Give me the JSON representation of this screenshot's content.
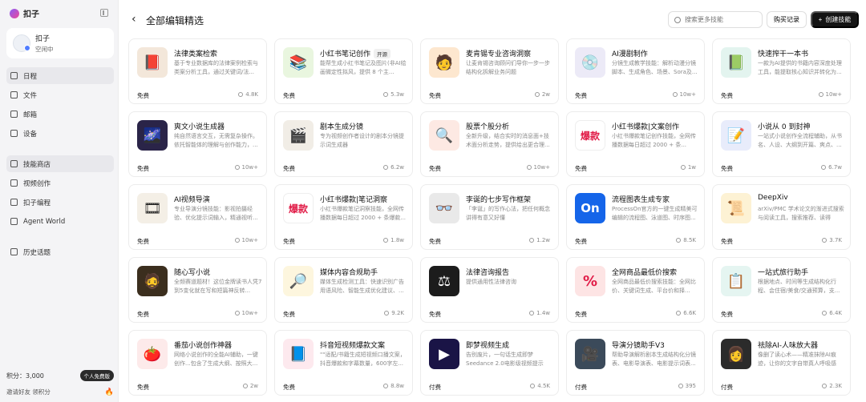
{
  "app": {
    "name": "扣子"
  },
  "user": {
    "name": "扣子",
    "status": "空闲中"
  },
  "nav_top": [
    {
      "label": "日程",
      "icon": "calendar-icon",
      "active": true
    },
    {
      "label": "文件",
      "icon": "folder-icon",
      "active": false
    },
    {
      "label": "邮箱",
      "icon": "mail-icon",
      "active": false
    },
    {
      "label": "设备",
      "icon": "device-icon",
      "active": false
    }
  ],
  "nav_mid": [
    {
      "label": "技能商店",
      "icon": "store-icon",
      "active": true
    },
    {
      "label": "视频创作",
      "icon": "video-icon",
      "active": false
    },
    {
      "label": "扣子编程",
      "icon": "code-icon",
      "active": false
    },
    {
      "label": "Agent World",
      "icon": "world-icon",
      "active": false
    }
  ],
  "nav_bottom": [
    {
      "label": "历史话题",
      "icon": "history-icon",
      "active": false
    }
  ],
  "footer": {
    "points": "积分：3,000",
    "plan": "个人免费版",
    "invite": "邀请好友 领积分"
  },
  "header": {
    "title": "全部编辑精选",
    "search_placeholder": "搜索更多技能",
    "buy_label": "购买记录",
    "create_label": "创建技能"
  },
  "cards": [
    {
      "title": "法律类案检索",
      "tag": "",
      "desc": "基于专业数据库的法律案例检索与类案分析工具，通过关键词/法...",
      "price": "免费",
      "users": "4.8K",
      "thumb": "📕",
      "bg": "#f3e7da"
    },
    {
      "title": "小红书笔记创作",
      "tag": "开源",
      "desc": "能帮生成小红书笔记及图片(非AI绘画微定性拟风，提供 8 个主...",
      "price": "免费",
      "users": "5.3w",
      "thumb": "📚",
      "bg": "#e9f6df"
    },
    {
      "title": "麦肯锡专业咨询洞察",
      "tag": "",
      "desc": "让麦肯锡咨询顾问们导你一步一步结构化拆解业务问题",
      "price": "免费",
      "users": "2w",
      "thumb": "🧑",
      "bg": "#fde7cf"
    },
    {
      "title": "AI漫剧制作",
      "tag": "",
      "desc": "分镜生成教学技能：解析动漫分镜脚本、生成角色、场景、Sora及...",
      "price": "免费",
      "users": "10w+",
      "thumb": "💿",
      "bg": "#eceaf7"
    },
    {
      "title": "快速搾干一本书",
      "tag": "",
      "desc": "一款为AI提供的书籍内容深度处理工具，能提取核心知识并转化为...",
      "price": "免费",
      "users": "10w+",
      "thumb": "📗",
      "bg": "#e3f4ef"
    },
    {
      "title": "爽文小说生成器",
      "tag": "",
      "desc": "纯自然语言交互，无需复杂操作。依托智能体的理解与创作能力，...",
      "price": "免费",
      "users": "10w+",
      "thumb": "🌌",
      "bg": "#2a2448"
    },
    {
      "title": "剧本生成分镜",
      "tag": "",
      "desc": "专为视频创作者设计的剧本分镜提示词生成器",
      "price": "免费",
      "users": "6.2w",
      "thumb": "🎬",
      "bg": "#f1ede6"
    },
    {
      "title": "股票个股分析",
      "tag": "",
      "desc": "全新升级，结合实时的消息面+技术面分析走势，提供给出更合理...",
      "price": "免费",
      "users": "10w+",
      "thumb": "🔍",
      "bg": "#fde9e3"
    },
    {
      "title": "小红书爆款|文案创作",
      "tag": "",
      "desc": "小红书爆款笔记创作技能，全网传播数据每日超过 2000 + 条...",
      "price": "免费",
      "users": "1w",
      "thumb": "爆款",
      "bg": "#ffffff"
    },
    {
      "title": "小说从 0 到封神",
      "tag": "",
      "desc": "一站式小说创作全流程辅助，从书名、人设、大纲到开篇、爽点、...",
      "price": "免费",
      "users": "6.7w",
      "thumb": "📝",
      "bg": "#e8ecfb"
    },
    {
      "title": "AI视频导演",
      "tag": "",
      "desc": "专业导演分镜技能：影视拍摄经验、优化提示词输入，精通视听...",
      "price": "免费",
      "users": "10w+",
      "thumb": "🎞",
      "bg": "#f4efe6"
    },
    {
      "title": "小红书爆款|笔记洞察",
      "tag": "",
      "desc": "小红书爆款笔记洞察技能，全网传播数据每日超过 2000 + 条爆款...",
      "price": "免费",
      "users": "1.8w",
      "thumb": "爆款",
      "bg": "#ffffff"
    },
    {
      "title": "李诞的七步写作框架",
      "tag": "",
      "desc": "「李诞」的写作心法，把任何概念讲得有意又好懂",
      "price": "免费",
      "users": "1.2w",
      "thumb": "👓",
      "bg": "#e9e9e9"
    },
    {
      "title": "流程图表生成专家",
      "tag": "",
      "desc": "ProcessOn官方的一键生成精美可编辑的流程图、泳道图、时序图...",
      "price": "免费",
      "users": "8.5K",
      "thumb": "On",
      "bg": "#1565e9"
    },
    {
      "title": "DeepXiv",
      "tag": "",
      "desc": "arXiv/PMC 学术论文的渐进式搜索与阅读工具，搜索推荐、读得着。...",
      "price": "免费",
      "users": "3.7K",
      "thumb": "📜",
      "bg": "#fdf2d4"
    },
    {
      "title": "随心写小说",
      "tag": "",
      "desc": "全频赛道题材！这位金牌读书人凭7到5变化就在写和短篇神反转...",
      "price": "免费",
      "users": "10w+",
      "thumb": "🧔",
      "bg": "#3b2e1e"
    },
    {
      "title": "媒体内容合规助手",
      "tag": "",
      "desc": "媒体生成检测工具：快速识别广告用语风险、智能生成优化建议、...",
      "price": "免费",
      "users": "9.2K",
      "thumb": "🔎",
      "bg": "#fdf6de"
    },
    {
      "title": "法律咨询报告",
      "tag": "",
      "desc": "提供通用性法律咨询",
      "price": "免费",
      "users": "1.4w",
      "thumb": "⚖",
      "bg": "#1c1c1c"
    },
    {
      "title": "全网商品最低价搜索",
      "tag": "",
      "desc": "全网商品最低价搜索技能：全网比价、关键词生成、平台价和择...",
      "price": "免费",
      "users": "6.6K",
      "thumb": "%",
      "bg": "#fde4e4"
    },
    {
      "title": "一站式旅行助手",
      "tag": "",
      "desc": "根据地点、时间等生成结构化行程、会住宿/美食/交通预算，支...",
      "price": "免费",
      "users": "6.4K",
      "thumb": "📋",
      "bg": "#e5f5f1"
    },
    {
      "title": "番茄小说创作神器",
      "tag": "",
      "desc": "网络小说创作的全能AI辅助，一键创作...包含了生成大纲、按照大...",
      "price": "免费",
      "users": "2w",
      "thumb": "🍅",
      "bg": "#fdeaea"
    },
    {
      "title": "抖音短视频爆款文案",
      "tag": "",
      "desc": "\"\"适配/书籍生成短视频口播文案，抖音爆款和字幕数量，600字左...",
      "price": "免费",
      "users": "8.8w",
      "thumb": "📘",
      "bg": "#fde9ee"
    },
    {
      "title": "即梦视频生成",
      "tag": "",
      "desc": "告别废片，一句话生成即梦Seedance 2.0电影级视频提示词。",
      "price": "付费",
      "users": "4.5K",
      "thumb": "▶",
      "bg": "#1a1446"
    },
    {
      "title": "导演分镜助手V3",
      "tag": "",
      "desc": "帮助导演解析剧本生成结构化分镜表、电影导演表、电影提示词表...",
      "price": "付费",
      "users": "395",
      "thumb": "🎥",
      "bg": "#3b4a5a"
    },
    {
      "title": "祛除AI-人味放大器",
      "tag": "",
      "desc": "像删了读心术——精准抹除AI痕迹，让你的文字自带真人呼吸感",
      "price": "付费",
      "users": "2.3K",
      "thumb": "👩",
      "bg": "#2b2b2b"
    }
  ]
}
